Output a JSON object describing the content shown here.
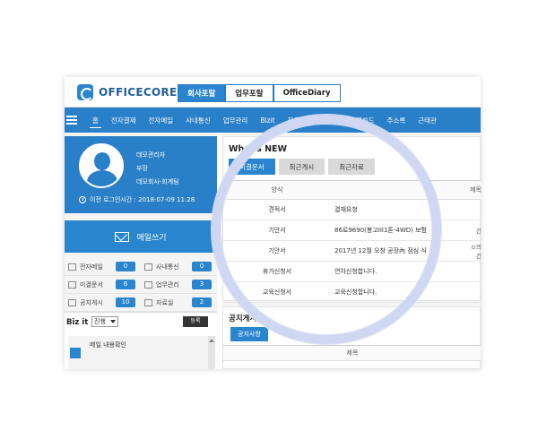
{
  "header": {
    "logo_text": "OFFICECORE",
    "tabs": [
      {
        "label": "회사포탈",
        "active": true
      },
      {
        "label": "업무포탈",
        "active": false
      },
      {
        "label": "OfficeDiary",
        "active": false
      }
    ]
  },
  "nav": {
    "items": [
      "홈",
      "전자결재",
      "전자메일",
      "사내통신",
      "업무관리",
      "Bizit",
      "자료실",
      "공지게시",
      "웹하드",
      "주소록",
      "근태관"
    ]
  },
  "profile": {
    "name": "데모관리자",
    "position": "부장",
    "department": "데모회사-회계팀",
    "last_login": "이전 로그인시간 : 2018-07-09 11:28"
  },
  "mail_button": {
    "label": "메일쓰기"
  },
  "counts": [
    {
      "label": "전자메일",
      "value": "0",
      "icon": "mail-icon"
    },
    {
      "label": "사내통신",
      "value": "0",
      "icon": "link-icon"
    },
    {
      "label": "미결문서",
      "value": "6",
      "icon": "document-icon"
    },
    {
      "label": "업무관리",
      "value": "3",
      "icon": "folder-icon"
    },
    {
      "label": "공지게시",
      "value": "10",
      "icon": "notice-icon"
    },
    {
      "label": "자료실",
      "value": "2",
      "icon": "storage-icon"
    }
  ],
  "bizit": {
    "title": "Biz it",
    "select_value": "진행",
    "register_label": "등록",
    "item_text": "메일 내용확인"
  },
  "whats_new": {
    "title": "What's NEW",
    "tabs": [
      {
        "label": "미결문서",
        "active": true
      },
      {
        "label": "최근게시",
        "active": false
      },
      {
        "label": "최근자료",
        "active": false
      }
    ],
    "columns": {
      "form": "양식",
      "title": "제목"
    },
    "rows": [
      {
        "form": "견적서",
        "title": "결재요청",
        "extra": ""
      },
      {
        "form": "기안서",
        "title": "86로9690(봉고III1톤-4WD) 보험",
        "extra": "건"
      },
      {
        "form": "기안서",
        "title": "2017년 12월 오창 공장內 점심 식",
        "extra": "ㅁ의 건"
      },
      {
        "form": "휴가신청서",
        "title": "연차신청합니다.",
        "extra": ""
      },
      {
        "form": "교육신청서",
        "title": "교육신청합니다.",
        "extra": ""
      }
    ]
  },
  "notice": {
    "title": "공지게시",
    "tab_label": "공지사항",
    "column_title": "제목"
  },
  "colors": {
    "primary": "#2a85cf",
    "nav_bg": "#2a7fc9",
    "lens_ring": "#cfd7f3"
  }
}
